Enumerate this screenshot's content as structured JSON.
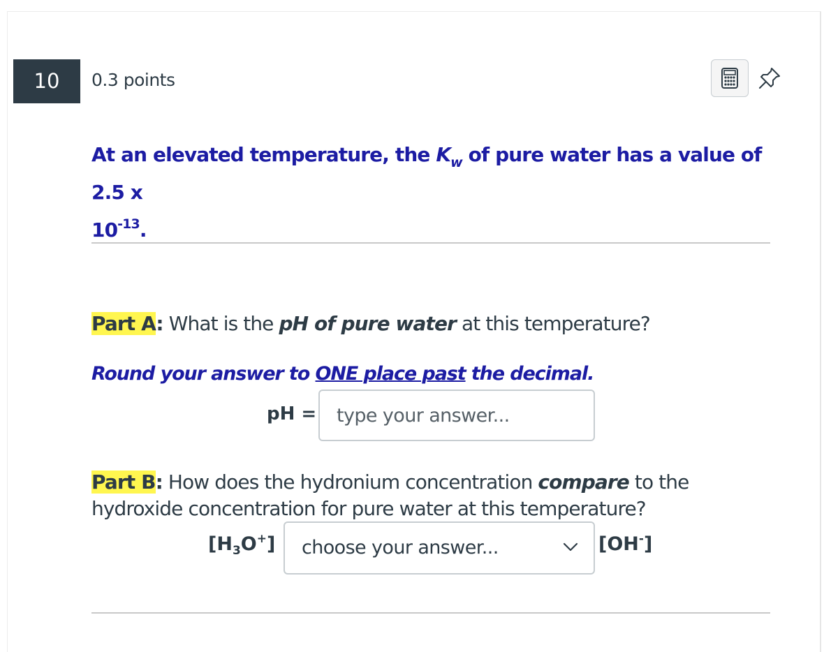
{
  "question": {
    "number": "10",
    "points": "0.3 points",
    "stem": {
      "prefix": "At an elevated temperature, the ",
      "k": "K",
      "k_sub": "w",
      "middle": " of pure water has a value of 2.5 x",
      "line2_base": "10",
      "line2_sup": "-13",
      "line2_end": "."
    }
  },
  "toolbar": {
    "calculator_icon": "calculator-icon",
    "pin_icon": "pin-icon"
  },
  "partA": {
    "label": "Part A",
    "colon": ":",
    "text1": " What is the ",
    "emph": "pH of pure water",
    "text2": " at this temperature?",
    "round_pre": "Round your answer to ",
    "round_underlined": "ONE place past",
    "round_post": " the decimal.",
    "input_label": "pH =",
    "input_placeholder": "type your answer...",
    "input_value": ""
  },
  "partB": {
    "label": "Part B",
    "colon": ":",
    "text1": " How does the hydronium concentration ",
    "emph": "compare",
    "text2": " to the hydroxide concentration for pure water at this temperature?",
    "left_open": "[H",
    "left_sub": "3",
    "left_mid": "O",
    "left_sup": "+",
    "left_close": "]",
    "select_value": "choose your answer...",
    "right_open": "[OH",
    "right_sup": "-",
    "right_close": "]"
  },
  "colors": {
    "question_badge": "#2d3b45",
    "stem_text": "#1c1ca3",
    "highlight": "#fff64f",
    "body_text": "#2d3b45"
  }
}
